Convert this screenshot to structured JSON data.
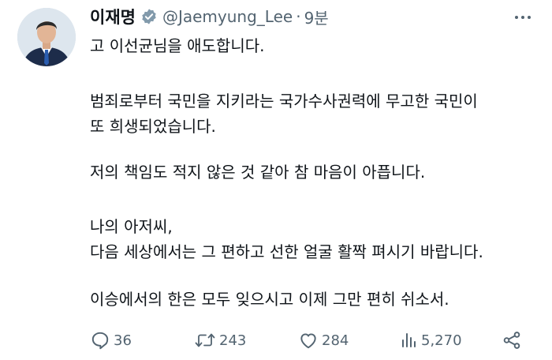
{
  "tweet": {
    "author": {
      "name": "이재명",
      "handle": "@Jaemyung_Lee",
      "separator": "·",
      "time": "9분"
    },
    "lines": [
      "고 이선균님을 애도합니다.",
      "범죄로부터 국민을 지키라는 국가수사권력에 무고한 국민이",
      "또 희생되었습니다.",
      "저의 책임도 적지 않은 것 같아 참 마음이 아픕니다.",
      "나의 아저씨,",
      "다음 세상에서는 그 편하고 선한 얼굴 활짝 펴시기 바랍니다.",
      "이승에서의 한은 모두 잊으시고 이제 그만 편히 쉬소서."
    ],
    "actions": {
      "reply": {
        "icon": "reply-icon",
        "count": "36"
      },
      "retweet": {
        "icon": "retweet-icon",
        "count": "243"
      },
      "like": {
        "icon": "heart-icon",
        "count": "284"
      },
      "views": {
        "icon": "views-icon",
        "count": "5,270"
      },
      "share": {
        "icon": "share-icon"
      }
    },
    "colors": {
      "text": "#0f1419",
      "secondary": "#536471",
      "verified": "#829aab"
    }
  }
}
